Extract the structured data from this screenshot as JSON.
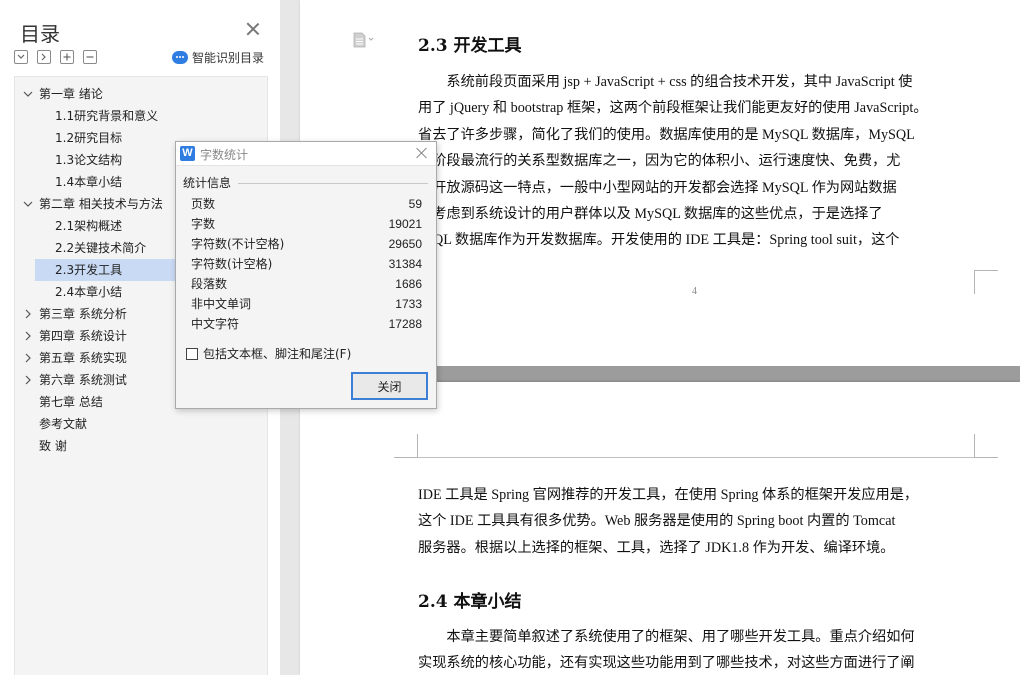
{
  "sidebar": {
    "title": "目录",
    "smart_toc_label": "智能识别目录",
    "items": [
      {
        "label": "第一章  绪论",
        "level": 1,
        "arrow": "expanded"
      },
      {
        "label": "1.1研究背景和意义",
        "level": 2,
        "arrow": "none"
      },
      {
        "label": "1.2研究目标",
        "level": 2,
        "arrow": "none"
      },
      {
        "label": "1.3论文结构",
        "level": 2,
        "arrow": "none"
      },
      {
        "label": "1.4本章小结",
        "level": 2,
        "arrow": "none"
      },
      {
        "label": "第二章  相关技术与方法",
        "level": 1,
        "arrow": "expanded"
      },
      {
        "label": "2.1架构概述",
        "level": 2,
        "arrow": "none"
      },
      {
        "label": "2.2关键技术简介",
        "level": 2,
        "arrow": "none"
      },
      {
        "label": "2.3开发工具",
        "level": 2,
        "arrow": "none",
        "selected": true
      },
      {
        "label": "2.4本章小结",
        "level": 2,
        "arrow": "none"
      },
      {
        "label": "第三章  系统分析",
        "level": 1,
        "arrow": "collapsed"
      },
      {
        "label": "第四章  系统设计",
        "level": 1,
        "arrow": "collapsed"
      },
      {
        "label": "第五章  系统实现",
        "level": 1,
        "arrow": "collapsed"
      },
      {
        "label": "第六章  系统测试",
        "level": 1,
        "arrow": "collapsed"
      },
      {
        "label": "第七章  总结",
        "level": 1,
        "arrow": "none"
      },
      {
        "label": "参考文献",
        "level": 1,
        "arrow": "none"
      },
      {
        "label": "致    谢",
        "level": 1,
        "arrow": "none"
      }
    ]
  },
  "dialog": {
    "title": "字数统计",
    "group_label": "统计信息",
    "stats": [
      {
        "label": "页数",
        "value": "59"
      },
      {
        "label": "字数",
        "value": "19021"
      },
      {
        "label": "字符数(不计空格)",
        "value": "29650"
      },
      {
        "label": "字符数(计空格)",
        "value": "31384"
      },
      {
        "label": "段落数",
        "value": "1686"
      },
      {
        "label": "非中文单词",
        "value": "1733"
      },
      {
        "label": "中文字符",
        "value": "17288"
      }
    ],
    "checkbox_label": "包括文本框、脚注和尾注(F)",
    "checkbox_checked": false,
    "close_button": "关闭"
  },
  "document": {
    "page1": {
      "heading": "2.3  开发工具",
      "lines": [
        "　　系统前段页面采用 jsp + JavaScript + css 的组合技术开发，其中 JavaScript 使",
        "用了 jQuery 和 bootstrap 框架，这两个前段框架让我们能更友好的使用 JavaScript。",
        "省去了许多步骤，简化了我们的使用。数据库使用的是 MySQL 数据库，MySQL",
        "现阶段最流行的关系型数据库之一，因为它的体积小、运行速度快、免费，尤",
        "是开放源码这一特点，一般中小型网站的开发都会选择 MySQL 作为网站数据",
        "。考虑到系统设计的用户群体以及 MySQL 数据库的这些优点，于是选择了",
        "ySQL 数据库作为开发数据库。开发使用的 IDE 工具是：Spring tool suit，这个"
      ],
      "page_number": "4"
    },
    "page2": {
      "lines": [
        "IDE 工具是 Spring 官网推荐的开发工具，在使用 Spring 体系的框架开发应用是，",
        "这个 IDE 工具具有很多优势。Web 服务器是使用的 Spring boot 内置的 Tomcat",
        "服务器。根据以上选择的框架、工具，选择了 JDK1.8 作为开发、编译环境。"
      ],
      "heading": "2.4  本章小结",
      "lines2": [
        "　　本章主要简单叙述了系统使用了的框架、用了哪些开发工具。重点介绍如何",
        "实现系统的核心功能，还有实现这些功能用到了哪些技术，对这些方面进行了阐"
      ]
    }
  }
}
